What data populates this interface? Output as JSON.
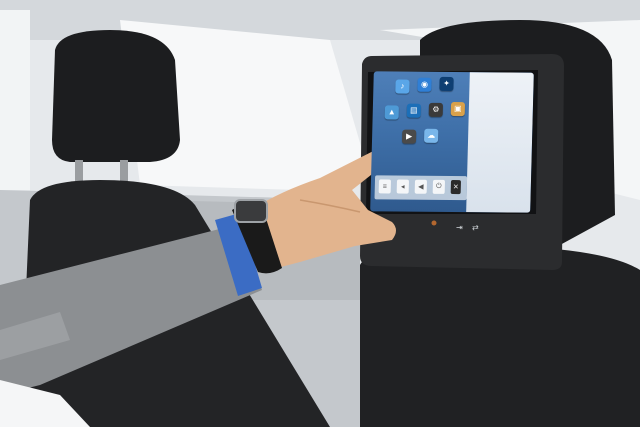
{
  "colors": {
    "interior": "#dfe3e6",
    "seat": "#1c1d1f",
    "monitor": "#2b2c2e",
    "screen": "#3e6fa8",
    "sleeve": "#8c8f92",
    "cuff": "#3b6cc4",
    "skin": "#e2b48e",
    "watch": "#1a1a1a"
  },
  "screen": {
    "apps": [
      {
        "icon": "music-icon",
        "color": "#5aa6e8",
        "glyph": "♪"
      },
      {
        "icon": "globe-icon",
        "color": "#2f7fd6",
        "glyph": "◉"
      },
      {
        "icon": "game-icon",
        "color": "#0e3e72",
        "glyph": "✦"
      },
      {
        "icon": "map-icon",
        "color": "#4e9ad6",
        "glyph": "▲"
      },
      {
        "icon": "book-icon",
        "color": "#1c6fb8",
        "glyph": "▤"
      },
      {
        "icon": "settings-icon",
        "color": "#3a3a3a",
        "glyph": "⚙"
      },
      {
        "icon": "photo-icon",
        "color": "#d9a14a",
        "glyph": "▣"
      },
      {
        "icon": "video-icon",
        "color": "#4a4a4a",
        "glyph": "▶"
      },
      {
        "icon": "weather-icon",
        "color": "#79b6ea",
        "glyph": "☁"
      }
    ],
    "dock": [
      {
        "icon": "menu-icon",
        "glyph": "≡"
      },
      {
        "icon": "back-icon",
        "glyph": "◂"
      },
      {
        "icon": "volume-icon",
        "glyph": "◀"
      },
      {
        "icon": "power-icon",
        "glyph": "⏻"
      },
      {
        "icon": "close-icon",
        "glyph": "✕"
      }
    ]
  },
  "bezel": {
    "buttons": [
      {
        "icon": "input-icon",
        "glyph": "⇥"
      },
      {
        "icon": "switch-icon",
        "glyph": "⇄"
      }
    ]
  }
}
